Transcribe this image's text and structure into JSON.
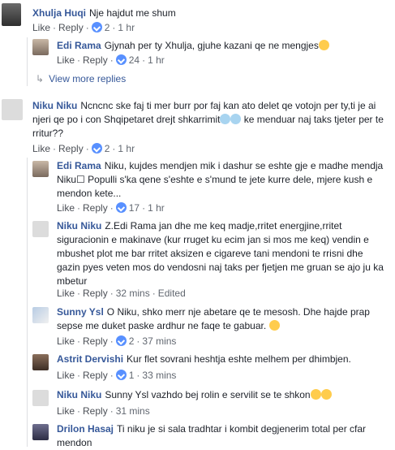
{
  "comments": [
    {
      "name": "Xhulja Huqi",
      "text": "Nje hajdut me shum",
      "like": "Like",
      "reply": "Reply",
      "likes": "2",
      "time": "1 hr"
    },
    {
      "name": "Edi Rama",
      "text": "Gjynah per ty Xhulja, gjuhe kazani qe ne mengjes",
      "like": "Like",
      "reply": "Reply",
      "likes": "24",
      "time": "1 hr"
    },
    {
      "name": "Niku Niku",
      "text": "Ncncnc ske faj ti mer burr por faj kan ato delet qe votojn per ty,ti je ai njeri qe po i con Shqipetaret drejt shkarrimit",
      "text2": " ke menduar naj taks tjeter per te rritur??",
      "like": "Like",
      "reply": "Reply",
      "likes": "2",
      "time": "1 hr"
    },
    {
      "name": "Edi Rama",
      "text": "Niku, kujdes mendjen mik i dashur se eshte gje e madhe mendja Niku☐ Populli s'ka qene s'eshte e s'mund te jete kurre dele, mjere kush e mendon kete...",
      "like": "Like",
      "reply": "Reply",
      "likes": "17",
      "time": "1 hr"
    },
    {
      "name": "Niku Niku",
      "text": "Z.Edi Rama jan dhe me keq madje,rritet energjine,rritet siguracionin e makinave (kur rruget ku ecim jan si mos me keq) vendin e mbushet plot me bar rritet aksizen e cigareve tani mendoni te rrisni dhe gazin pyes veten mos do vendosni naj taks per fjetjen me gruan se ajo ju ka mbetur",
      "like": "Like",
      "reply": "Reply",
      "time": "32 mins",
      "edited": "Edited"
    },
    {
      "name": "Sunny Ysl",
      "text": "O Niku, shko merr nje abetare qe te mesosh. Dhe hajde prap sepse me duket paske ardhur ne faqe te gabuar.",
      "like": "Like",
      "reply": "Reply",
      "likes": "2",
      "time": "37 mins"
    },
    {
      "name": "Astrit Dervishi",
      "text": "Kur flet sovrani heshtja eshte melhem per dhimbjen.",
      "like": "Like",
      "reply": "Reply",
      "likes": "1",
      "time": "33 mins"
    },
    {
      "name": "Niku Niku",
      "text": "Sunny Ysl vazhdo bej rolin e servilit se te shkon",
      "like": "Like",
      "reply": "Reply",
      "time": "31 mins"
    },
    {
      "name": "Drilon Hasaj",
      "text": "Ti niku je si sala tradhtar i kombit degjenerim total per cfar mendon"
    }
  ],
  "view_more": "View more replies",
  "colors": {
    "link": "#365899",
    "meta": "#616770",
    "like_blue": "#5890ff"
  }
}
